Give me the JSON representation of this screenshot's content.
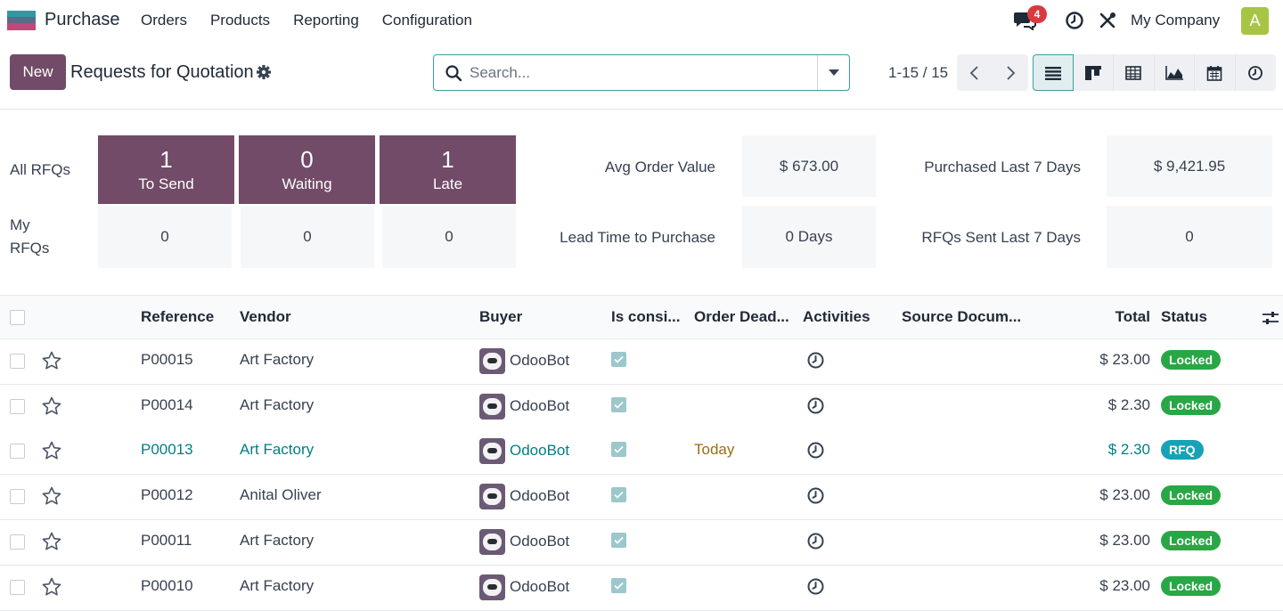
{
  "navbar": {
    "app_name": "Purchase",
    "menu": [
      "Orders",
      "Products",
      "Reporting",
      "Configuration"
    ],
    "chat_badge": "4",
    "company": "My Company",
    "avatar_letter": "A"
  },
  "control": {
    "new_label": "New",
    "title": "Requests for Quotation",
    "search_placeholder": "Search...",
    "pager": "1-15 / 15",
    "views": [
      "list",
      "kanban",
      "pivot",
      "graph",
      "calendar",
      "activity"
    ],
    "active_view": "list"
  },
  "dashboard": {
    "all_label": "All RFQs",
    "my_label_1": "My",
    "my_label_2": "RFQs",
    "tiles": [
      {
        "num": "1",
        "label": "To Send"
      },
      {
        "num": "0",
        "label": "Waiting"
      },
      {
        "num": "1",
        "label": "Late"
      }
    ],
    "my_values": [
      "0",
      "0",
      "0"
    ],
    "stats": {
      "avg_order_label": "Avg Order Value",
      "avg_order_value": "$ 673.00",
      "lead_time_label": "Lead Time to Purchase",
      "lead_time_value": "0 Days",
      "purchased_label": "Purchased Last 7 Days",
      "purchased_value": "$ 9,421.95",
      "sent_label": "RFQs Sent Last 7 Days",
      "sent_value": "0"
    }
  },
  "table": {
    "headers": {
      "reference": "Reference",
      "vendor": "Vendor",
      "buyer": "Buyer",
      "consignment": "Is consi...",
      "deadline": "Order Dead...",
      "activities": "Activities",
      "source": "Source Docum...",
      "total": "Total",
      "status": "Status"
    },
    "rows": [
      {
        "ref": "P00015",
        "vendor": "Art Factory",
        "buyer": "OdooBot",
        "deadline": "",
        "total": "$ 23.00",
        "status": "Locked"
      },
      {
        "ref": "P00014",
        "vendor": "Art Factory",
        "buyer": "OdooBot",
        "deadline": "",
        "total": "$ 2.30",
        "status": "Locked"
      },
      {
        "ref": "P00013",
        "vendor": "Art Factory",
        "buyer": "OdooBot",
        "deadline": "Today",
        "total": "$ 2.30",
        "status": "RFQ"
      },
      {
        "ref": "P00012",
        "vendor": "Anital Oliver",
        "buyer": "OdooBot",
        "deadline": "",
        "total": "$ 23.00",
        "status": "Locked"
      },
      {
        "ref": "P00011",
        "vendor": "Art Factory",
        "buyer": "OdooBot",
        "deadline": "",
        "total": "$ 23.00",
        "status": "Locked"
      },
      {
        "ref": "P00010",
        "vendor": "Art Factory",
        "buyer": "OdooBot",
        "deadline": "",
        "total": "$ 23.00",
        "status": "Locked"
      }
    ]
  },
  "colors": {
    "brand": "#714b67",
    "accent": "#017e84",
    "locked": "#28a745",
    "rfq": "#17a2b8"
  }
}
